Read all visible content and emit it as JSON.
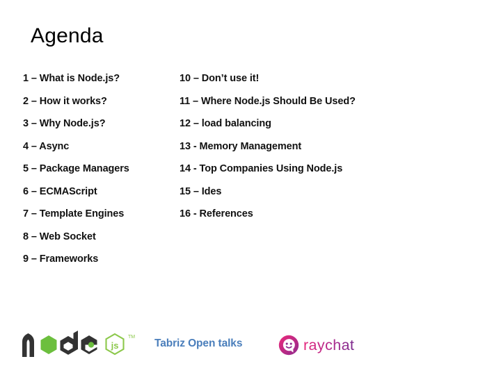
{
  "slide": {
    "title": "Agenda",
    "background_color": "#ffffff"
  },
  "agenda": {
    "left_column": [
      {
        "label": "1 – What is Node.js?"
      },
      {
        "label": "2 – How it works?"
      },
      {
        "label": "3 – Why Node.js?"
      },
      {
        "label": "4 – Async"
      },
      {
        "label": "5 – Package Managers"
      },
      {
        "label": "6 – ECMAScript"
      },
      {
        "label": "7 – Template Engines"
      },
      {
        "label": "8 – Web Socket"
      },
      {
        "label": "9 – Frameworks"
      }
    ],
    "right_column": [
      {
        "label": "10 – Don’t use it!"
      },
      {
        "label": "11 – Where Node.js Should Be Used?"
      },
      {
        "label": "12 – load balancing"
      },
      {
        "label": "13 - Memory Management"
      },
      {
        "label": "14 - Top Companies Using Node.js"
      },
      {
        "label": "15 – Ides"
      },
      {
        "label": "16 - References"
      }
    ]
  },
  "footer": {
    "node_logo": {
      "icon": "nodejs-logo",
      "wordmark": "node",
      "badge_text": "js",
      "trademark": "TM",
      "dark_color": "#333333",
      "green_color": "#6cbf3e",
      "badge_color": "#8cc84b"
    },
    "event_text": "Tabriz Open talks",
    "event_text_color": "#4a7ebb",
    "raychat_logo": {
      "icon": "raychat-bubble-icon",
      "wordmark": "raychat",
      "gradient_start": "#e6287d",
      "gradient_end": "#7b2c8f"
    }
  }
}
